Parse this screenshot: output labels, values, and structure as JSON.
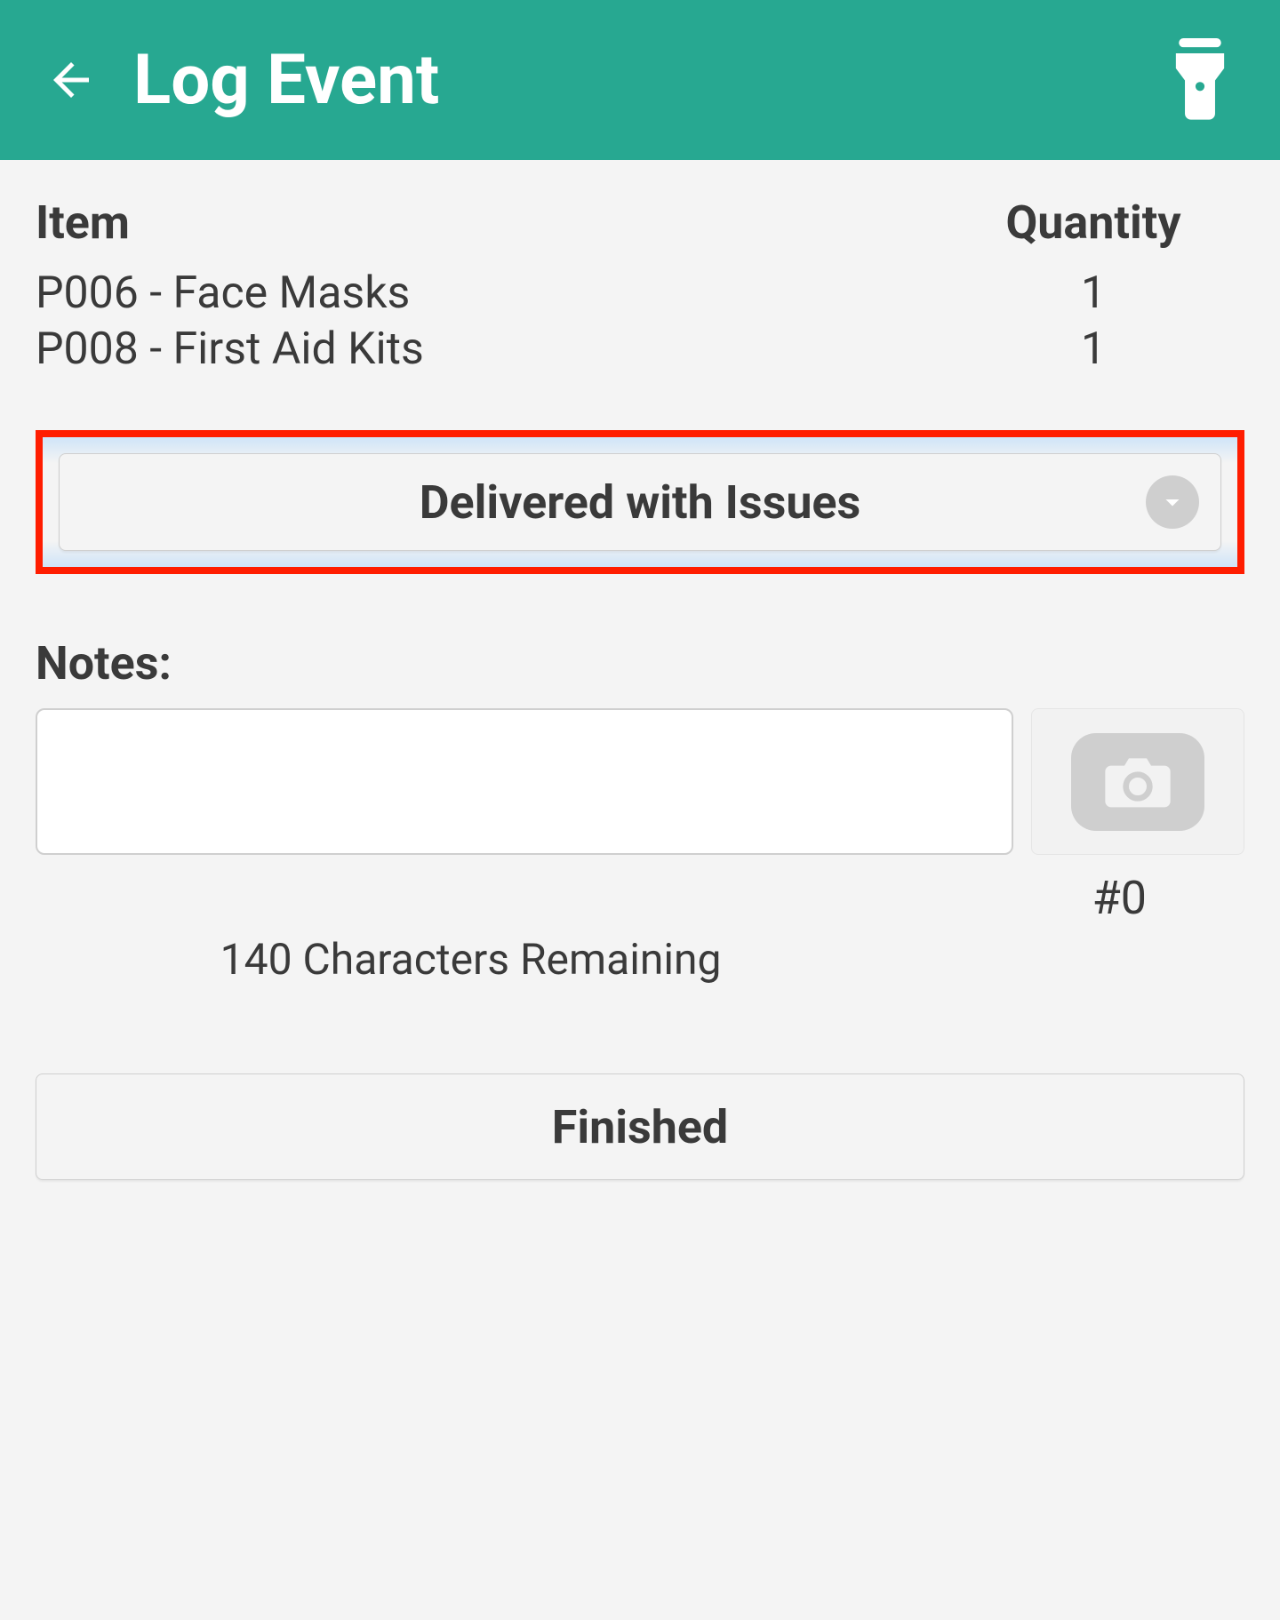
{
  "header": {
    "title": "Log Event"
  },
  "table": {
    "headers": {
      "item": "Item",
      "quantity": "Quantity"
    },
    "rows": [
      {
        "item": "P006 - Face Masks",
        "quantity": "1"
      },
      {
        "item": "P008 - First Aid Kits",
        "quantity": "1"
      }
    ]
  },
  "status": {
    "selected": "Delivered with Issues"
  },
  "notes": {
    "label": "Notes:",
    "value": "",
    "placeholder": "",
    "chars_remaining": "140 Characters Remaining",
    "photo_count": "#0"
  },
  "actions": {
    "finished_label": "Finished"
  }
}
